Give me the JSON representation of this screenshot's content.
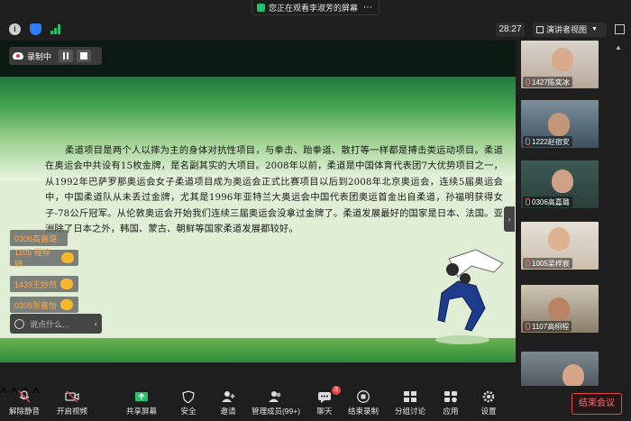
{
  "banner": {
    "text": "您正在观看李淑芳的屏幕",
    "more": "⋯"
  },
  "status": {
    "timer": "28:27",
    "view_label": "演讲者视图"
  },
  "recording": {
    "label": "录制中"
  },
  "slide": {
    "paragraph": "柔道项目是两个人以摔为主的身体对抗性项目，与拳击、跆拳道、散打等一样都是搏击类运动项目。柔道在奥运会中共设有15枚金牌，是名副其实的大项目。2008年以前，柔道是中国体育代表团7大优势项目之一，从1992年巴萨罗那奥运会女子柔道项目成为奥运会正式比赛项目以后到2008年北京奥运会，连续5届奥运会中，中国柔道队从未丢过金牌，尤其是1996年亚特兰大奥运会中国代表团奥运首金出自柔道，孙福明获得女子-78公斤冠军。从伦敦奥运会开始我们连续三届奥运会没拿过金牌了。柔道发展最好的国家是日本、法国。亚洲除了日本之外，韩国、蒙古、朝鲜等国家柔道发展都较好。"
  },
  "chat": {
    "messages": [
      {
        "name": "0306高嘉璐",
        "text": ""
      },
      {
        "name": "1105 程梓妍",
        "text": ""
      },
      {
        "name": "1439王妙然",
        "text": ""
      },
      {
        "name": "0305张嘉怡",
        "text": ""
      }
    ],
    "input_placeholder": "说点什么..."
  },
  "participants": [
    {
      "name": "1427陈奕冰"
    },
    {
      "name": "1222赵宿安"
    },
    {
      "name": "0306高嘉璐"
    },
    {
      "name": "1005梁梓宸"
    },
    {
      "name": "1107高栩程"
    },
    {
      "name": ""
    }
  ],
  "toolbar": {
    "unmute": "解除静音",
    "start_video": "开启视频",
    "share_screen": "共享屏幕",
    "security": "安全",
    "invite": "邀请",
    "members": "管理成员(99+)",
    "chat": "聊天",
    "chat_badge": "3",
    "end_recording": "结束录制",
    "breakout": "分组讨论",
    "apps": "应用",
    "settings": "设置",
    "end_meeting": "结束会议"
  },
  "colors": {
    "accent_green": "#23c16b",
    "end_red": "#e5484d",
    "chat_name": "#ffa64d"
  }
}
